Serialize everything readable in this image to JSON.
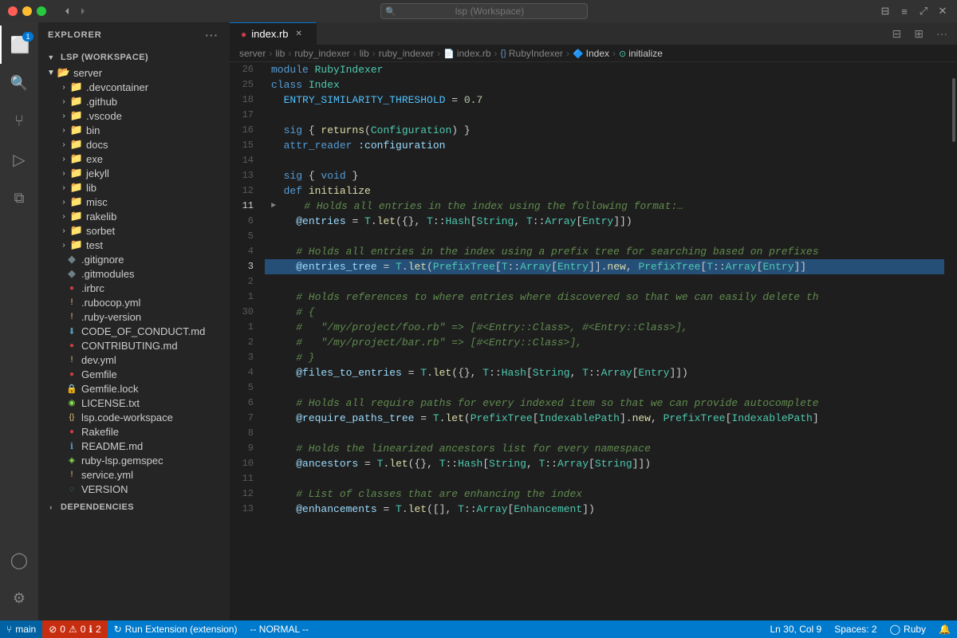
{
  "titlebar": {
    "search_placeholder": "lsp (Workspace)",
    "traffic": [
      "close",
      "minimize",
      "maximize"
    ]
  },
  "activity_bar": {
    "icons": [
      {
        "name": "files-icon",
        "symbol": "⊞",
        "active": true,
        "badge": "1"
      },
      {
        "name": "search-icon",
        "symbol": "🔍",
        "active": false
      },
      {
        "name": "source-control-icon",
        "symbol": "⑂",
        "active": false
      },
      {
        "name": "run-icon",
        "symbol": "▷",
        "active": false
      },
      {
        "name": "extensions-icon",
        "symbol": "⧉",
        "active": false
      }
    ],
    "bottom_icons": [
      {
        "name": "account-icon",
        "symbol": "◯"
      },
      {
        "name": "settings-icon",
        "symbol": "⚙"
      }
    ]
  },
  "sidebar": {
    "title": "Explorer",
    "workspace_label": "LSP (WORKSPACE)",
    "tree": [
      {
        "label": "server",
        "type": "folder",
        "expanded": true,
        "depth": 1,
        "icon": "📁"
      },
      {
        "label": ".devcontainer",
        "type": "folder",
        "expanded": false,
        "depth": 2,
        "icon": "📁"
      },
      {
        "label": ".github",
        "type": "folder",
        "expanded": false,
        "depth": 2,
        "icon": "📁"
      },
      {
        "label": ".vscode",
        "type": "folder",
        "expanded": false,
        "depth": 2,
        "icon": "📁"
      },
      {
        "label": "bin",
        "type": "folder",
        "expanded": false,
        "depth": 2,
        "icon": "📁"
      },
      {
        "label": "docs",
        "type": "folder",
        "expanded": false,
        "depth": 2,
        "icon": "📁"
      },
      {
        "label": "exe",
        "type": "folder",
        "expanded": false,
        "depth": 2,
        "icon": "📁"
      },
      {
        "label": "jekyll",
        "type": "folder",
        "expanded": false,
        "depth": 2,
        "icon": "📁"
      },
      {
        "label": "lib",
        "type": "folder",
        "expanded": false,
        "depth": 2,
        "icon": "📁"
      },
      {
        "label": "misc",
        "type": "folder",
        "expanded": false,
        "depth": 2,
        "icon": "📁"
      },
      {
        "label": "rakelib",
        "type": "folder",
        "expanded": false,
        "depth": 2,
        "icon": "📁"
      },
      {
        "label": "sorbet",
        "type": "folder",
        "expanded": false,
        "depth": 2,
        "icon": "📁"
      },
      {
        "label": "test",
        "type": "folder",
        "expanded": false,
        "depth": 2,
        "icon": "📁"
      },
      {
        "label": ".gitignore",
        "type": "file",
        "depth": 2,
        "icon": "◆",
        "icon_color": "#6d8086"
      },
      {
        "label": ".gitmodules",
        "type": "file",
        "depth": 2,
        "icon": "◆",
        "icon_color": "#6d8086"
      },
      {
        "label": ".irbrc",
        "type": "file",
        "depth": 2,
        "icon": "●",
        "icon_color": "#cc3e44"
      },
      {
        "label": ".rubocop.yml",
        "type": "file",
        "depth": 2,
        "icon": "!",
        "icon_color": "#e5c07b"
      },
      {
        "label": ".ruby-version",
        "type": "file",
        "depth": 2,
        "icon": "!",
        "icon_color": "#e5c07b"
      },
      {
        "label": "CODE_OF_CONDUCT.md",
        "type": "file",
        "depth": 2,
        "icon": "⬇",
        "icon_color": "#519aba"
      },
      {
        "label": "CONTRIBUTING.md",
        "type": "file",
        "depth": 2,
        "icon": "●",
        "icon_color": "#cc3e44"
      },
      {
        "label": "dev.yml",
        "type": "file",
        "depth": 2,
        "icon": "!",
        "icon_color": "#e5c07b"
      },
      {
        "label": "Gemfile",
        "type": "file",
        "depth": 2,
        "icon": "●",
        "icon_color": "#cc3e44"
      },
      {
        "label": "Gemfile.lock",
        "type": "file",
        "depth": 2,
        "icon": "🔒",
        "icon_color": "#cccccc"
      },
      {
        "label": "LICENSE.txt",
        "type": "file",
        "depth": 2,
        "icon": "◉",
        "icon_color": "#89e051"
      },
      {
        "label": "lsp.code-workspace",
        "type": "file",
        "depth": 2,
        "icon": "{}",
        "icon_color": "#e5c07b"
      },
      {
        "label": "Rakefile",
        "type": "file",
        "depth": 2,
        "icon": "●",
        "icon_color": "#cc3e44"
      },
      {
        "label": "README.md",
        "type": "file",
        "depth": 2,
        "icon": "ℹ",
        "icon_color": "#519aba"
      },
      {
        "label": "ruby-lsp.gemspec",
        "type": "file",
        "depth": 2,
        "icon": "◈",
        "icon_color": "#89e051"
      },
      {
        "label": "service.yml",
        "type": "file",
        "depth": 2,
        "icon": "!",
        "icon_color": "#e5c07b"
      },
      {
        "label": "VERSION",
        "type": "file",
        "depth": 2,
        "icon": "◌",
        "icon_color": "#519aba"
      }
    ],
    "dependencies_label": "DEPENDENCIES"
  },
  "tabs": [
    {
      "label": "index.rb",
      "active": true,
      "icon": "●",
      "modified": true
    }
  ],
  "tab_bar_actions": [
    "split-editor",
    "more-actions"
  ],
  "breadcrumb": [
    {
      "label": "server"
    },
    {
      "label": "lib"
    },
    {
      "label": "ruby_indexer"
    },
    {
      "label": "lib"
    },
    {
      "label": "ruby_indexer"
    },
    {
      "label": "index.rb",
      "icon": "📄"
    },
    {
      "label": "RubyIndexer",
      "icon": "{}"
    },
    {
      "label": "Index",
      "icon": "🔷"
    },
    {
      "label": "initialize",
      "icon": "⊙"
    }
  ],
  "code_lines": [
    {
      "num": "26",
      "content": "module RubyIndexer",
      "type": "module"
    },
    {
      "num": "25",
      "content": "class Index",
      "type": "class"
    },
    {
      "num": "18",
      "content": "  ENTRY_SIMILARITY_THRESHOLD = 0.7",
      "type": "const"
    },
    {
      "num": "17",
      "content": "",
      "type": "blank"
    },
    {
      "num": "16",
      "content": "  sig { returns(Configuration) }",
      "type": "sig"
    },
    {
      "num": "15",
      "content": "  attr_reader :configuration",
      "type": "attr"
    },
    {
      "num": "14",
      "content": "",
      "type": "blank"
    },
    {
      "num": "13",
      "content": "  sig { void }",
      "type": "sig"
    },
    {
      "num": "12",
      "content": "  def initialize",
      "type": "def"
    },
    {
      "num": "11",
      "content": "    # Holds all entries in the index using the following format:…",
      "type": "comment",
      "arrow": true
    },
    {
      "num": "6",
      "content": "    @entries = T.let({}, T::Hash[String, T::Array[Entry]])",
      "type": "code"
    },
    {
      "num": "5",
      "content": "",
      "type": "blank"
    },
    {
      "num": "4",
      "content": "    # Holds all entries in the index using a prefix tree for searching based on prefixes",
      "type": "comment"
    },
    {
      "num": "3",
      "content": "    @entries_tree = T.let(PrefixTree[T::Array[Entry]].new, PrefixTree[T::Array[Entry]]",
      "type": "code",
      "current_line": true
    },
    {
      "num": "2",
      "content": "",
      "type": "blank"
    },
    {
      "num": "1",
      "content": "    # Holds references to where entries where discovered so that we can easily delete th",
      "type": "comment"
    },
    {
      "num": "30",
      "content": "    # {",
      "type": "comment"
    },
    {
      "num": "1",
      "content": "    #   \"/my/project/foo.rb\" => [#<Entry::Class>, #<Entry::Class>],",
      "type": "comment"
    },
    {
      "num": "2",
      "content": "    #   \"/my/project/bar.rb\" => [#<Entry::Class>],",
      "type": "comment"
    },
    {
      "num": "3",
      "content": "    # }",
      "type": "comment"
    },
    {
      "num": "4",
      "content": "    @files_to_entries = T.let({}, T::Hash[String, T::Array[Entry]])",
      "type": "code"
    },
    {
      "num": "5",
      "content": "",
      "type": "blank"
    },
    {
      "num": "6",
      "content": "    # Holds all require paths for every indexed item so that we can provide autocomplete",
      "type": "comment"
    },
    {
      "num": "7",
      "content": "    @require_paths_tree = T.let(PrefixTree[IndexablePath].new, PrefixTree[IndexablePath]",
      "type": "code"
    },
    {
      "num": "8",
      "content": "",
      "type": "blank"
    },
    {
      "num": "9",
      "content": "    # Holds the linearized ancestors list for every namespace",
      "type": "comment"
    },
    {
      "num": "10",
      "content": "    @ancestors = T.let({}, T::Hash[String, T::Array[String]])",
      "type": "code"
    },
    {
      "num": "11",
      "content": "",
      "type": "blank"
    },
    {
      "num": "12",
      "content": "    # List of classes that are enhancing the index",
      "type": "comment"
    },
    {
      "num": "13",
      "content": "    @enhancements = T.let([], T::Array[Enhancement])",
      "type": "code"
    }
  ],
  "statusbar": {
    "branch": "main",
    "errors": "0",
    "warnings": "0",
    "info": "2",
    "task": "Run Extension (extension)",
    "mode": "-- NORMAL --",
    "position": "Ln 30, Col 9",
    "spaces": "Spaces: 2",
    "encoding": "Ruby",
    "git_icon": "⑂",
    "error_icon": "⊘",
    "warning_icon": "⚠",
    "info_icon": "ℹ"
  }
}
